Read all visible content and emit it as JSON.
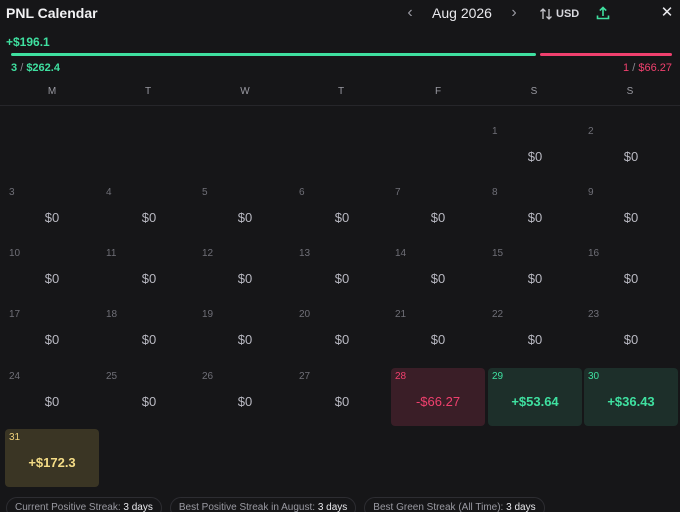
{
  "header": {
    "title": "PNL Calendar",
    "prev_icon": "chevron-left-icon",
    "month_label": "Aug 2026",
    "next_icon": "chevron-right-icon",
    "currency_icon": "sort-arrows-icon",
    "currency_label": "USD",
    "export_icon": "upload-icon",
    "close_icon": "close-icon",
    "close_glyph": "✕",
    "prev_glyph": "‹",
    "next_glyph": "›"
  },
  "summary": {
    "total": "+$196.1",
    "win_count": "3",
    "win_amount": "$262.4",
    "loss_count": "1",
    "loss_amount": "$66.27",
    "separator": "/",
    "win_share": 0.798,
    "colors": {
      "positive": "#3fe0a0",
      "negative": "#f0406e",
      "highlight": "#f4dc86"
    }
  },
  "weekdays": [
    "M",
    "T",
    "W",
    "T",
    "F",
    "S",
    "S"
  ],
  "days": [
    {
      "day": "1",
      "value": "$0",
      "status": "zero"
    },
    {
      "day": "2",
      "value": "$0",
      "status": "zero"
    },
    {
      "day": "3",
      "value": "$0",
      "status": "zero"
    },
    {
      "day": "4",
      "value": "$0",
      "status": "zero"
    },
    {
      "day": "5",
      "value": "$0",
      "status": "zero"
    },
    {
      "day": "6",
      "value": "$0",
      "status": "zero"
    },
    {
      "day": "7",
      "value": "$0",
      "status": "zero"
    },
    {
      "day": "8",
      "value": "$0",
      "status": "zero"
    },
    {
      "day": "9",
      "value": "$0",
      "status": "zero"
    },
    {
      "day": "10",
      "value": "$0",
      "status": "zero"
    },
    {
      "day": "11",
      "value": "$0",
      "status": "zero"
    },
    {
      "day": "12",
      "value": "$0",
      "status": "zero"
    },
    {
      "day": "13",
      "value": "$0",
      "status": "zero"
    },
    {
      "day": "14",
      "value": "$0",
      "status": "zero"
    },
    {
      "day": "15",
      "value": "$0",
      "status": "zero"
    },
    {
      "day": "16",
      "value": "$0",
      "status": "zero"
    },
    {
      "day": "17",
      "value": "$0",
      "status": "zero"
    },
    {
      "day": "18",
      "value": "$0",
      "status": "zero"
    },
    {
      "day": "19",
      "value": "$0",
      "status": "zero"
    },
    {
      "day": "20",
      "value": "$0",
      "status": "zero"
    },
    {
      "day": "21",
      "value": "$0",
      "status": "zero"
    },
    {
      "day": "22",
      "value": "$0",
      "status": "zero"
    },
    {
      "day": "23",
      "value": "$0",
      "status": "zero"
    },
    {
      "day": "24",
      "value": "$0",
      "status": "zero"
    },
    {
      "day": "25",
      "value": "$0",
      "status": "zero"
    },
    {
      "day": "26",
      "value": "$0",
      "status": "zero"
    },
    {
      "day": "27",
      "value": "$0",
      "status": "zero"
    },
    {
      "day": "28",
      "value": "-$66.27",
      "status": "neg"
    },
    {
      "day": "29",
      "value": "+$53.64",
      "status": "pos"
    },
    {
      "day": "30",
      "value": "+$36.43",
      "status": "pos"
    },
    {
      "day": "31",
      "value": "+$172.3",
      "status": "best"
    }
  ],
  "streaks": [
    {
      "label": "Current Positive Streak:",
      "value": "3 days"
    },
    {
      "label": "Best Positive Streak in August:",
      "value": "3 days"
    },
    {
      "label": "Best Green Streak (All Time):",
      "value": "3 days"
    }
  ]
}
